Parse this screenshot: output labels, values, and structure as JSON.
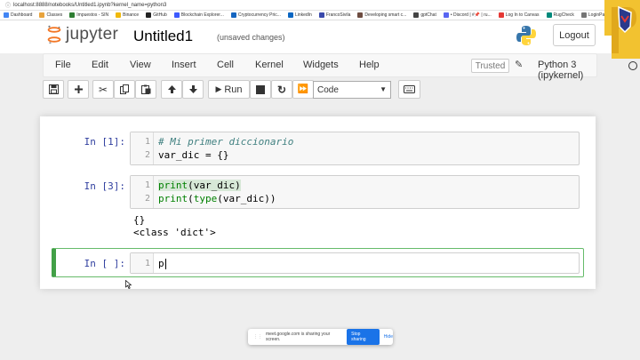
{
  "browser": {
    "url": "localhost:8888/notebooks/Untitled1.ipynb?kernel_name=python3",
    "bookmarks": [
      {
        "label": "Dashboard",
        "color": "#4285f4"
      },
      {
        "label": "Classes",
        "color": "#e8a33d"
      },
      {
        "label": "Impuestos - SIN",
        "color": "#2e7d32"
      },
      {
        "label": "Binance",
        "color": "#f0b90b"
      },
      {
        "label": "GitHub",
        "color": "#222222"
      },
      {
        "label": "Blockchain Explorer...",
        "color": "#3d5afe"
      },
      {
        "label": "Cryptocurrency Pric...",
        "color": "#1565c0"
      },
      {
        "label": "LinkedIn",
        "color": "#0a66c2"
      },
      {
        "label": "FrancoSivila",
        "color": "#3949ab"
      },
      {
        "label": "Developing smart c...",
        "color": "#6d4c41"
      },
      {
        "label": "gptChat",
        "color": "#444444"
      },
      {
        "label": "• Discord | #📌 | ru...",
        "color": "#5865f2"
      },
      {
        "label": "Log In to Canvas",
        "color": "#e53935"
      },
      {
        "label": "RugCheck",
        "color": "#00897b"
      },
      {
        "label": "LoginPa...",
        "color": "#757575"
      }
    ]
  },
  "header": {
    "logo_text": "jupyter",
    "notebook_title": "Untitled1",
    "autosave_status": "(unsaved changes)",
    "logout_label": "Logout"
  },
  "menubar": {
    "items": [
      "File",
      "Edit",
      "View",
      "Insert",
      "Cell",
      "Kernel",
      "Widgets",
      "Help"
    ],
    "trusted_label": "Trusted",
    "kernel_name": "Python 3 (ipykernel)"
  },
  "toolbar": {
    "run_label": "Run",
    "cell_type": "Code"
  },
  "cells": [
    {
      "prompt": "In [1]:",
      "lines": [
        "# Mi primer diccionario",
        "var_dic = {}"
      ],
      "line_numbers": [
        "1",
        "2"
      ]
    },
    {
      "prompt": "In [3]:",
      "lines": [
        "print(var_dic)",
        "print(type(var_dic))"
      ],
      "line_numbers": [
        "1",
        "2"
      ],
      "output": [
        "{}",
        "<class 'dict'>"
      ]
    },
    {
      "prompt": "In [ ]:",
      "lines": [
        "p"
      ],
      "line_numbers": [
        "1"
      ]
    }
  ],
  "sharebar": {
    "message": "meet.google.com is sharing your screen.",
    "stop_label": "Stop sharing",
    "hide_label": "Hide"
  },
  "colors": {
    "prompt": "#303f9f",
    "selected_cell": "#42a047",
    "comment": "#408080",
    "builtin": "#008000"
  }
}
